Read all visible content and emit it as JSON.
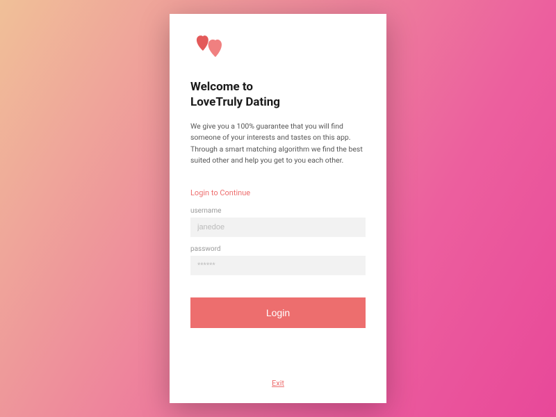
{
  "app": {
    "title": "Welcome to\nLoveTruly Dating",
    "description": "We give you a 100% guarantee that you will find someone of your interests and tastes on this app. Through a smart matching algorithm we find the best suited other and help you get to you each other.",
    "login_prompt": "Login to Continue",
    "colors": {
      "accent": "#ed6e6e",
      "heart_dark": "#e35a5a",
      "heart_light": "#f08080"
    }
  },
  "form": {
    "username": {
      "label": "username",
      "placeholder": "janedoe",
      "value": ""
    },
    "password": {
      "label": "password",
      "placeholder": "******",
      "value": ""
    },
    "login_button": "Login",
    "exit_link": "Exit"
  }
}
